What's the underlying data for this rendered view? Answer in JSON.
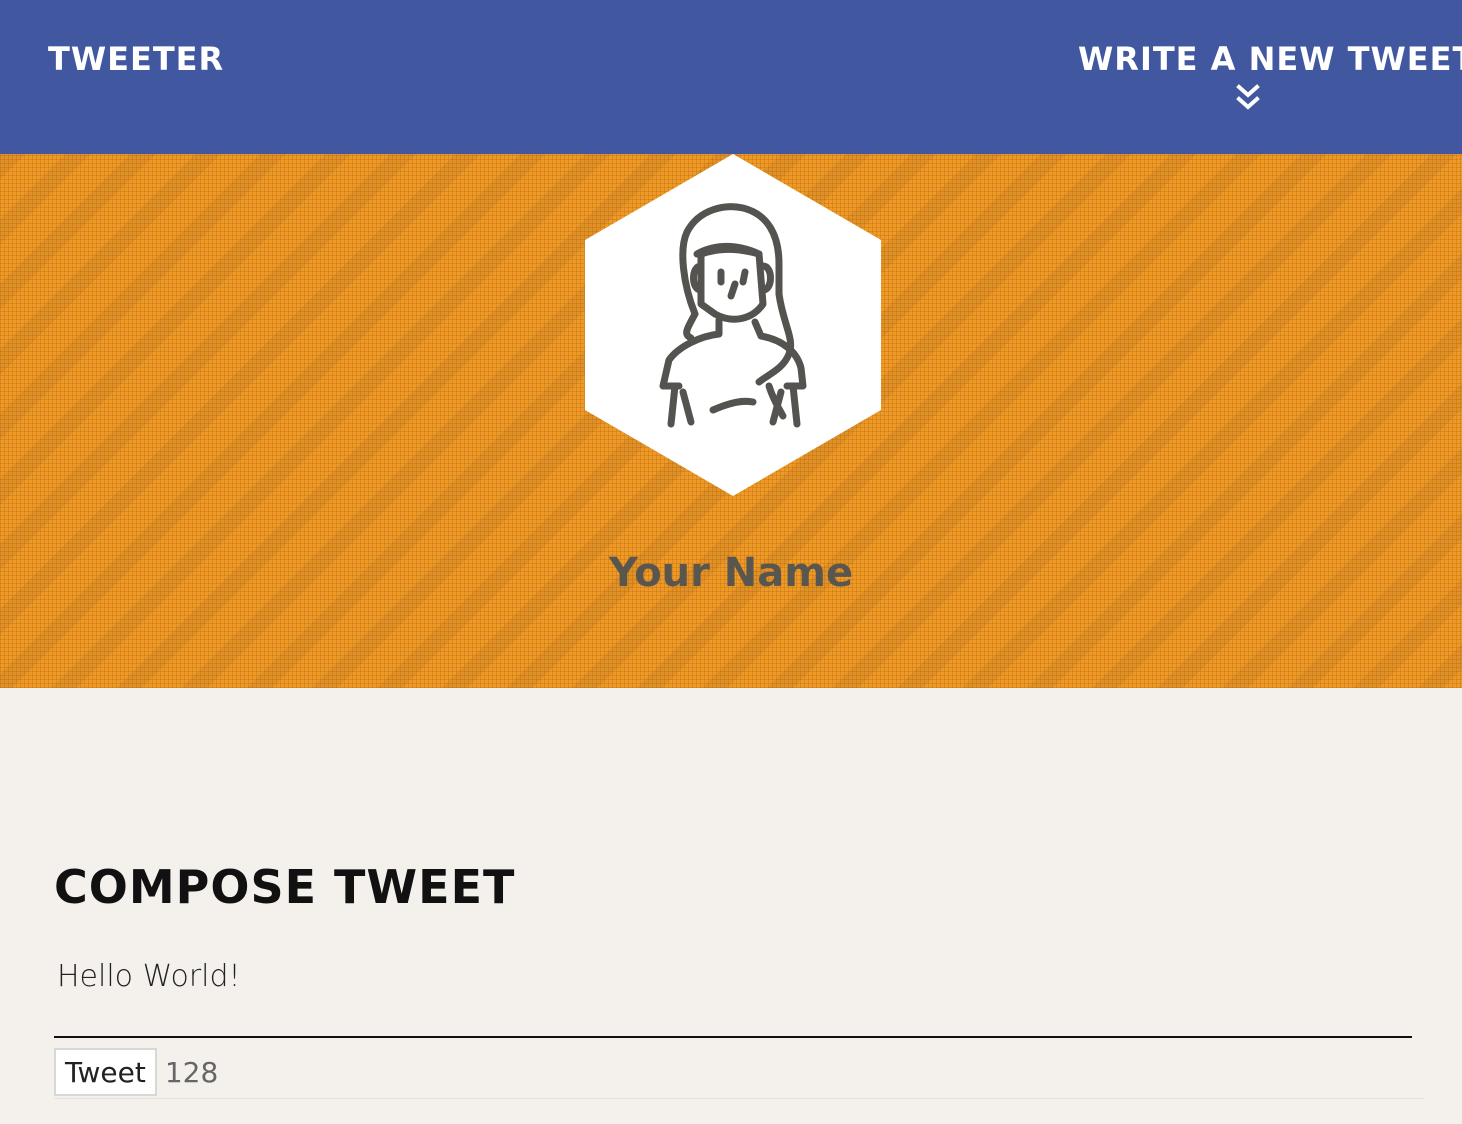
{
  "nav": {
    "brand": "Tweeter",
    "compose_toggle_label": "Write a new tweet",
    "compose_toggle_icon": "chevron-double-down-icon"
  },
  "profile": {
    "avatar_icon": "woman-avatar-icon",
    "name": "Your Name"
  },
  "compose": {
    "title": "Compose Tweet",
    "input_value": "Hello World!",
    "submit_label": "Tweet",
    "counter": "128"
  },
  "colors": {
    "nav_bg": "#4158a0",
    "header_bg": "#f09a25",
    "page_bg": "#f4f1ed",
    "name_text": "#595650"
  }
}
